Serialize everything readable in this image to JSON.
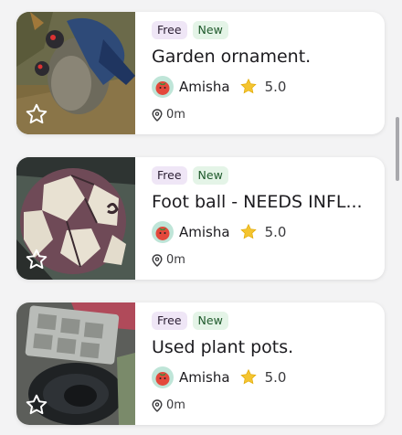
{
  "listings": [
    {
      "badges": [
        "Free",
        "New"
      ],
      "title": "Garden ornament.",
      "seller": "Amisha",
      "rating": "5.0",
      "distance": "0m",
      "image": "bird-garden-ornament-photo"
    },
    {
      "badges": [
        "Free",
        "New"
      ],
      "title": "Foot ball - NEEDS INFL...",
      "seller": "Amisha",
      "rating": "5.0",
      "distance": "0m",
      "image": "football-photo"
    },
    {
      "badges": [
        "Free",
        "New"
      ],
      "title": "Used plant pots.",
      "seller": "Amisha",
      "rating": "5.0",
      "distance": "0m",
      "image": "plant-pots-photo"
    }
  ],
  "colors": {
    "card": "#ffffff",
    "background": "#f3f3f4",
    "free_badge": "#efe6f6",
    "new_badge": "#e4f4e7",
    "star": "#f4c430"
  },
  "icons": {
    "favorite": "star-outline-icon",
    "rating": "star-filled-icon",
    "location": "map-pin-icon",
    "avatar": "tomato-avatar"
  }
}
